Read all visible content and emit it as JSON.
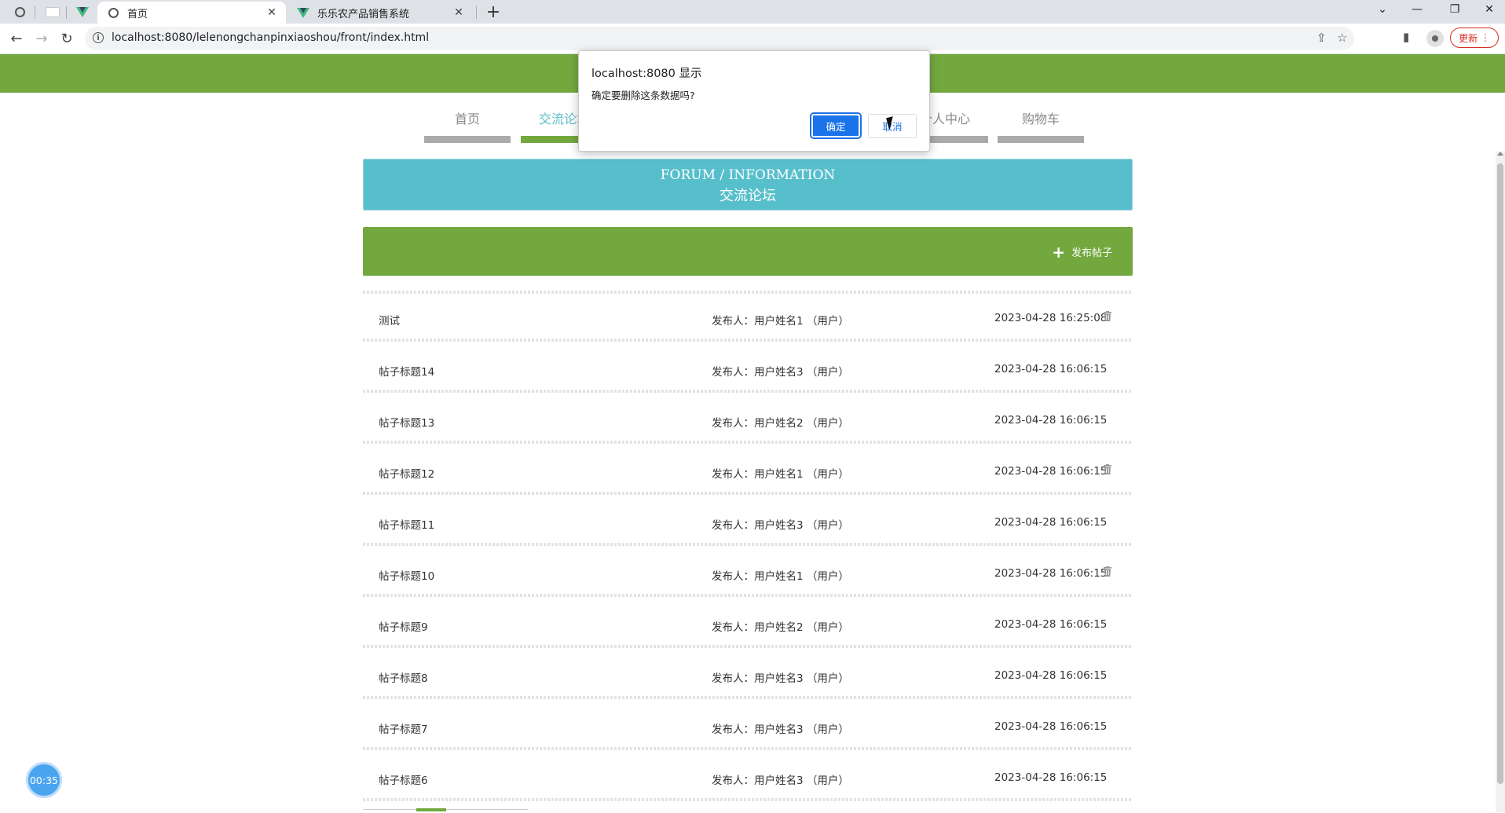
{
  "browser": {
    "tabs": [
      {
        "title": "首页",
        "active": true,
        "icon": "globe-icon"
      },
      {
        "title": "乐乐农产品销售系统",
        "active": false,
        "icon": "vue-logo-icon"
      }
    ],
    "url": "localhost:8080/lelenongchanpinxiaoshou/front/index.html",
    "update_label": "更新"
  },
  "nav": {
    "items": [
      {
        "label": "首页",
        "active": false
      },
      {
        "label": "交流论坛",
        "active": true
      },
      {
        "label": "个人中心",
        "active": false
      },
      {
        "label": "购物车",
        "active": false
      }
    ]
  },
  "banner": {
    "en": "FORUM / INFORMATION",
    "zh": "交流论坛"
  },
  "action_bar": {
    "post_label": "发布帖子"
  },
  "posts": [
    {
      "title": "测试",
      "author": "发布人：用户姓名1 （用户）",
      "time": "2023-04-28 16:25:08",
      "deletable": true
    },
    {
      "title": "帖子标题14",
      "author": "发布人：用户姓名3 （用户）",
      "time": "2023-04-28 16:06:15",
      "deletable": false
    },
    {
      "title": "帖子标题13",
      "author": "发布人：用户姓名2 （用户）",
      "time": "2023-04-28 16:06:15",
      "deletable": false
    },
    {
      "title": "帖子标题12",
      "author": "发布人：用户姓名1 （用户）",
      "time": "2023-04-28 16:06:15",
      "deletable": true
    },
    {
      "title": "帖子标题11",
      "author": "发布人：用户姓名3 （用户）",
      "time": "2023-04-28 16:06:15",
      "deletable": false
    },
    {
      "title": "帖子标题10",
      "author": "发布人：用户姓名1 （用户）",
      "time": "2023-04-28 16:06:15",
      "deletable": true
    },
    {
      "title": "帖子标题9",
      "author": "发布人：用户姓名2 （用户）",
      "time": "2023-04-28 16:06:15",
      "deletable": false
    },
    {
      "title": "帖子标题8",
      "author": "发布人：用户姓名3 （用户）",
      "time": "2023-04-28 16:06:15",
      "deletable": false
    },
    {
      "title": "帖子标题7",
      "author": "发布人：用户姓名3 （用户）",
      "time": "2023-04-28 16:06:15",
      "deletable": false
    },
    {
      "title": "帖子标题6",
      "author": "发布人：用户姓名3 （用户）",
      "time": "2023-04-28 16:06:15",
      "deletable": false
    }
  ],
  "dialog": {
    "title": "localhost:8080 显示",
    "message": "确定要删除这条数据吗?",
    "ok_label": "确定",
    "cancel_label": "取消"
  },
  "timer": "00:35",
  "colors": {
    "header_green": "#73a83f",
    "banner_teal": "#57bfcb",
    "dialog_blue": "#1a73e8"
  }
}
